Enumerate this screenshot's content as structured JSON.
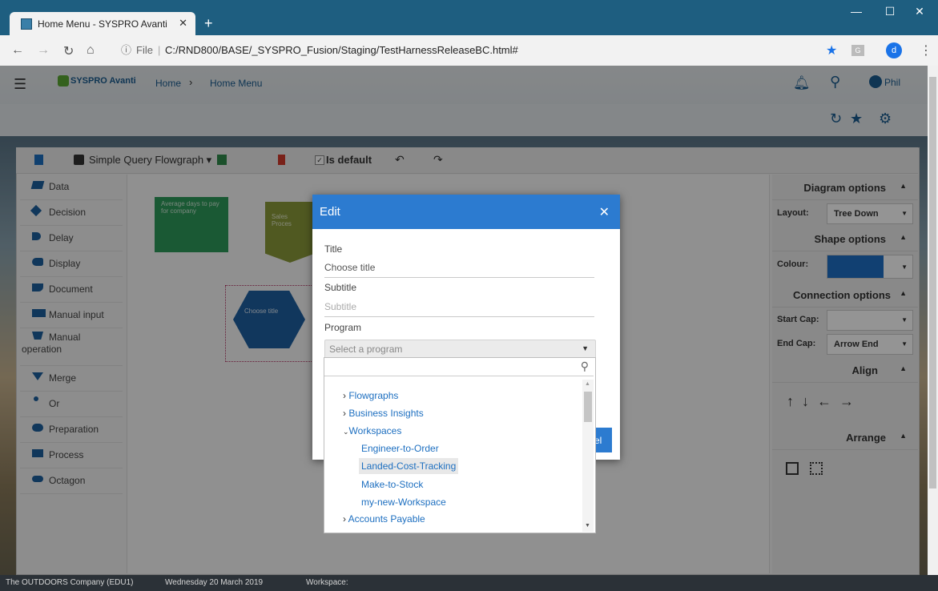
{
  "browser": {
    "tab_title": "Home Menu - SYSPRO Avanti",
    "url_prefix": "File",
    "url": "C:/RND800/BASE/_SYSPRO_Fusion/Staging/TestHarnessReleaseBC.html#",
    "profile_initial": "d"
  },
  "header": {
    "brand": "SYSPRO Avanti",
    "breadcrumb_home": "Home",
    "breadcrumb_current": "Home Menu",
    "user": "Phil"
  },
  "toolbar": {
    "query_label": "Simple Query Flowgraph ▾",
    "is_default_label": "Is default"
  },
  "shapes": [
    {
      "label": "Data"
    },
    {
      "label": "Decision"
    },
    {
      "label": "Delay"
    },
    {
      "label": "Display"
    },
    {
      "label": "Document"
    },
    {
      "label": "Manual input"
    },
    {
      "label": "Manual operation"
    },
    {
      "label": "Merge"
    },
    {
      "label": "Or"
    },
    {
      "label": "Preparation"
    },
    {
      "label": "Process"
    },
    {
      "label": "Octagon"
    }
  ],
  "canvas": {
    "node1": "Average days to pay for company",
    "node2": "Sales Proces",
    "node3": "Choose title"
  },
  "right_panel": {
    "diagram_options": "Diagram options",
    "layout_label": "Layout:",
    "layout_value": "Tree Down",
    "shape_options": "Shape options",
    "colour_label": "Colour:",
    "colour_value": "#1e6fc4",
    "connection_options": "Connection options",
    "start_cap_label": "Start Cap:",
    "start_cap_value": "",
    "end_cap_label": "End Cap:",
    "end_cap_value": "Arrow End",
    "align": "Align",
    "arrange": "Arrange"
  },
  "dialog": {
    "title": "Edit",
    "title_label": "Title",
    "title_value": "Choose title",
    "subtitle_label": "Subtitle",
    "subtitle_placeholder": "Subtitle",
    "program_label": "Program",
    "program_placeholder": "Select a program",
    "ok_fragment": "el",
    "options": [
      {
        "label": "Flowgraphs",
        "type": "group-collapsed"
      },
      {
        "label": "Business Insights",
        "type": "group-collapsed"
      },
      {
        "label": "Workspaces",
        "type": "group-expanded"
      },
      {
        "label": "Engineer-to-Order",
        "type": "item"
      },
      {
        "label": "Landed-Cost-Tracking",
        "type": "item-highlighted"
      },
      {
        "label": "Make-to-Stock",
        "type": "item"
      },
      {
        "label": "my-new-Workspace",
        "type": "item"
      },
      {
        "label": "Accounts Payable",
        "type": "group-collapsed"
      }
    ]
  },
  "status_bar": {
    "company": "The OUTDOORS Company (EDU1)",
    "date": "Wednesday 20  March 2019",
    "workspace_label": "Workspace:"
  },
  "colors": {
    "accent": "#2c7bd0",
    "tab_bar": "#1e5e80",
    "node_green": "#2e9a5a",
    "node_olive": "#8a9a3a",
    "node_blue": "#1e5fa0"
  }
}
